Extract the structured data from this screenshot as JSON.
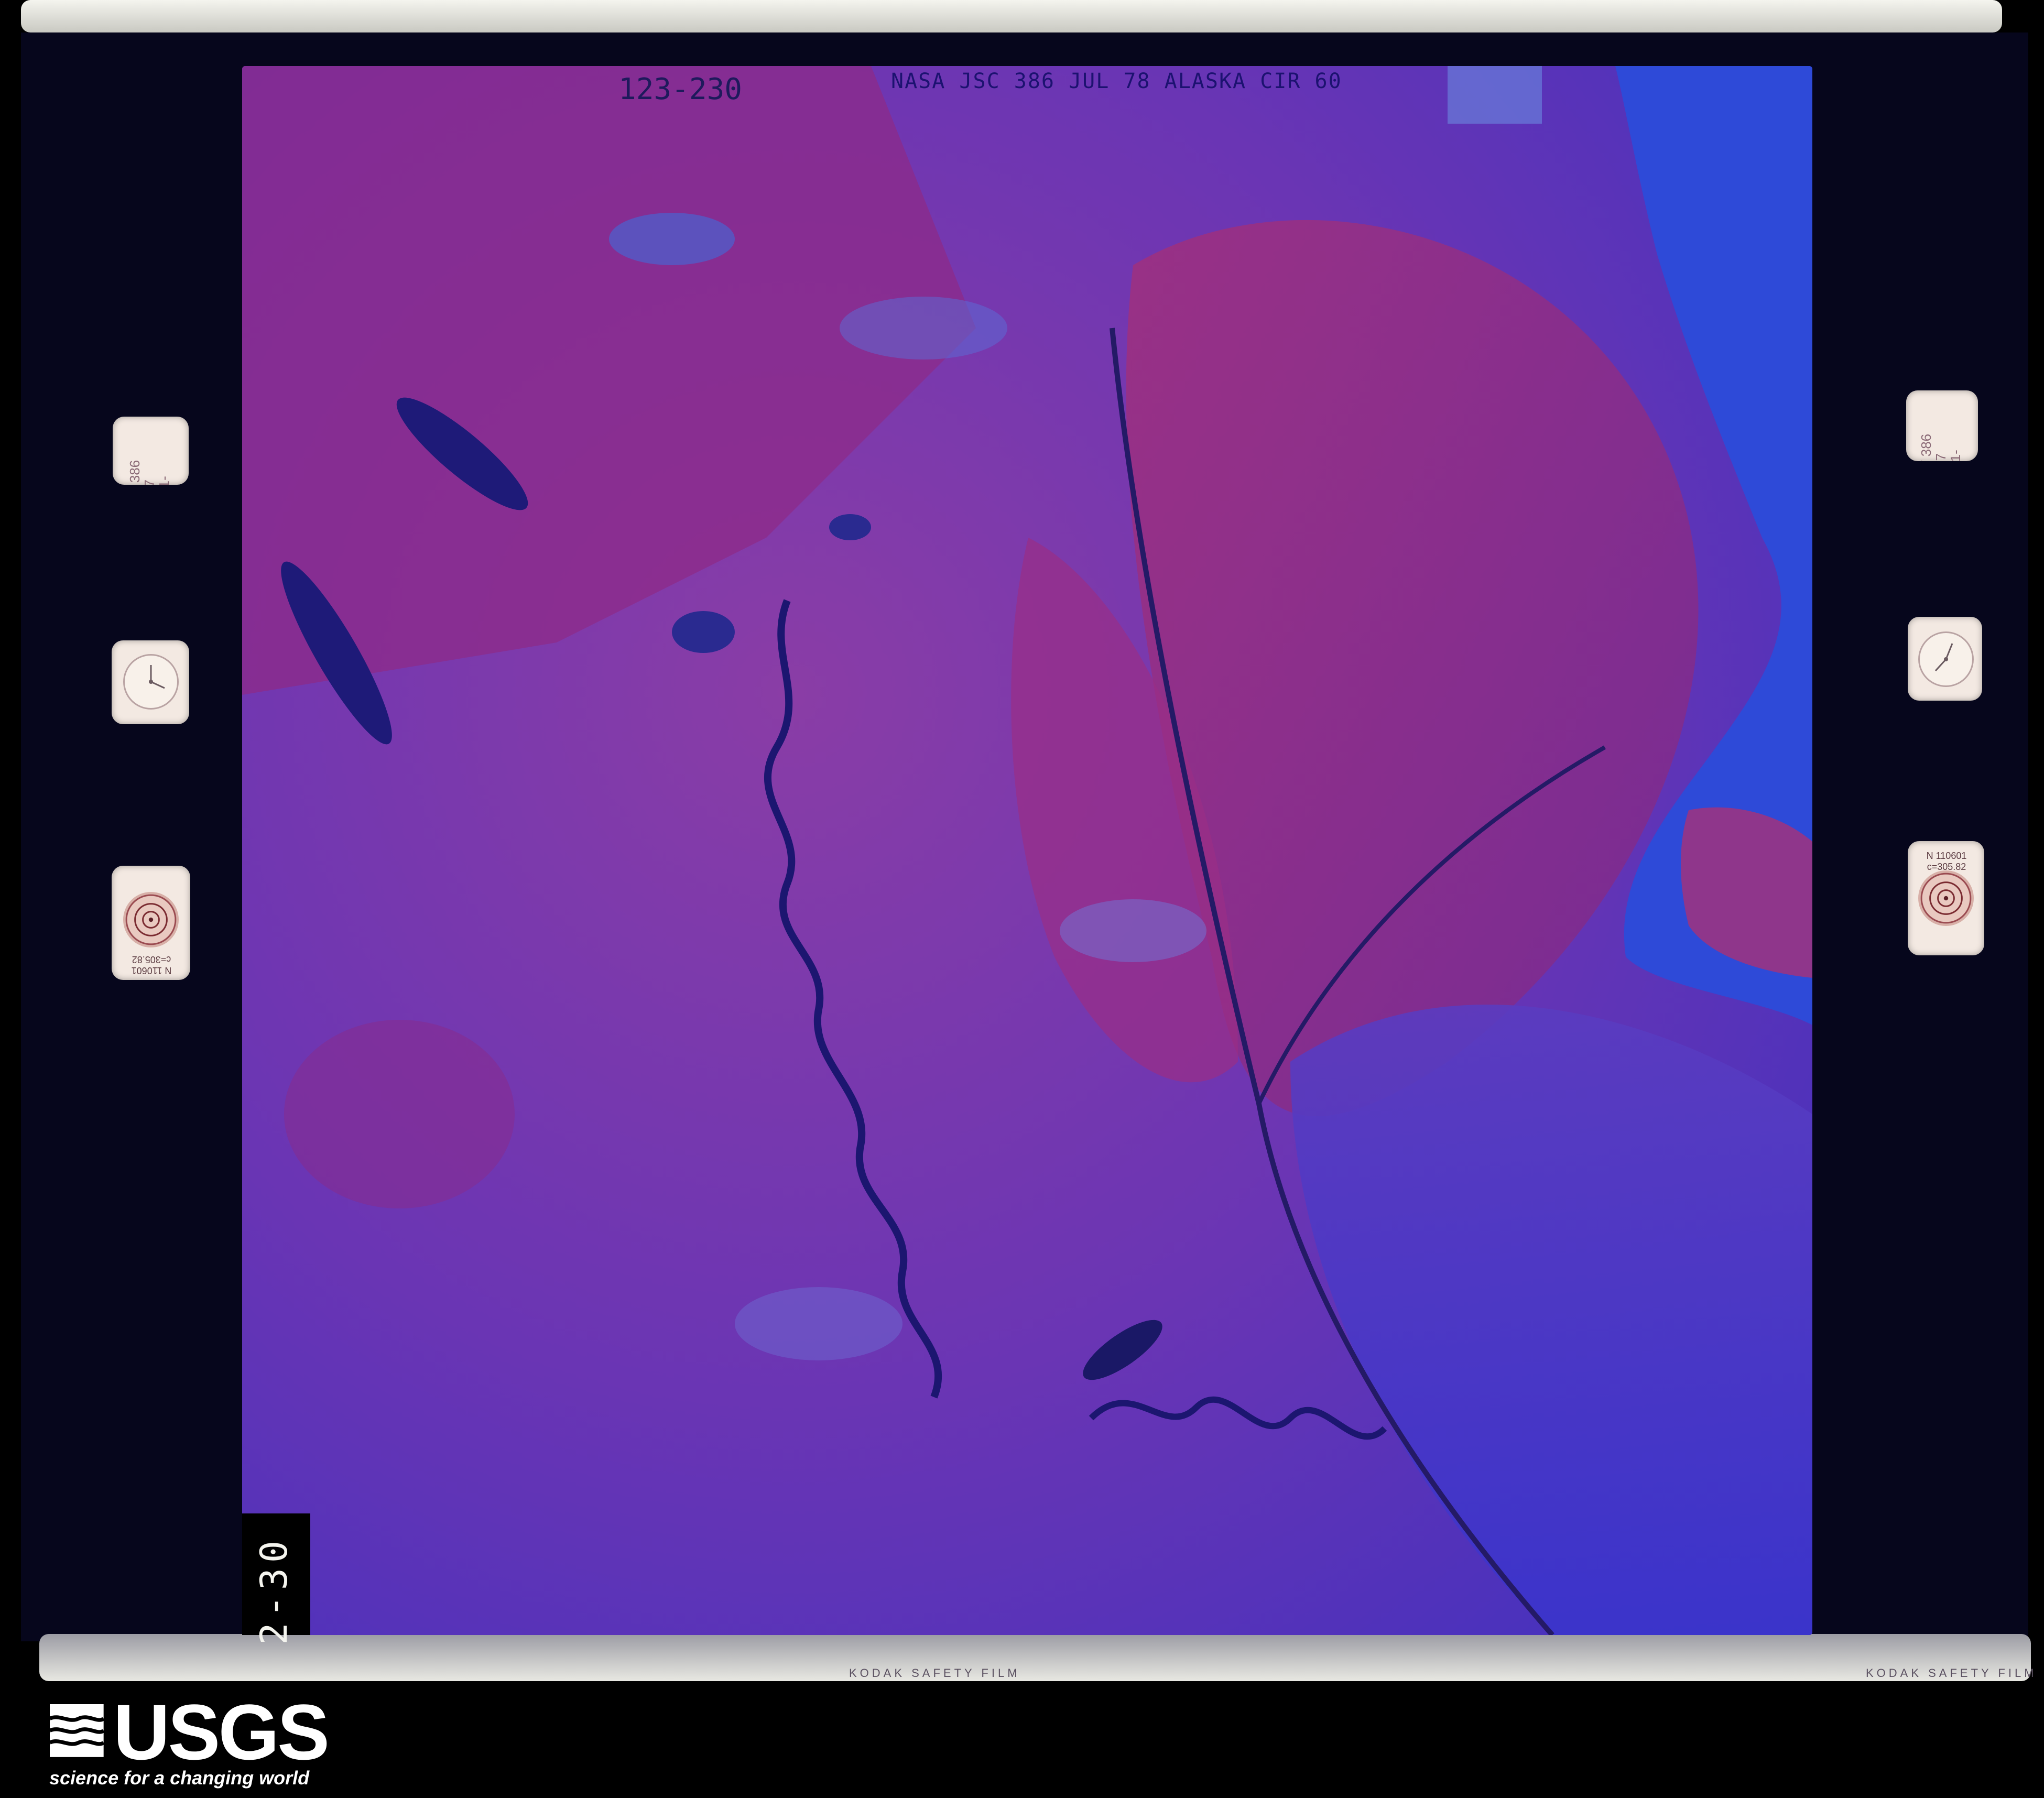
{
  "film": {
    "frame_id": "123-230",
    "header": "NASA JSC 386 JUL 78 ALASKA CIR 60",
    "frame_number": "2-30",
    "edge_print_bottom_left": "KODAK SAFETY FILM",
    "edge_print_bottom_right": "KODAK SAFETY FILM"
  },
  "side_labels": {
    "left_card": "MY 386\nFJ-7\n7-11-",
    "right_card": "MY 386\nFJ-7\n7-11-",
    "lens_left": "N 110601  c=305.82",
    "lens_right": "N 110601  c=305.82"
  },
  "branding": {
    "logo_word": "USGS",
    "tagline": "science for a changing world"
  },
  "colors": {
    "background": "#000000",
    "film_base": "#06061c",
    "land_infrared": "#8a2c8c",
    "water": "#2e48d8",
    "usgs_white": "#ffffff"
  },
  "icons": {
    "left_clock": "clock-icon",
    "right_clock": "clock-icon",
    "left_target": "fiducial-target-icon",
    "right_target": "fiducial-target-icon",
    "usgs_mark": "usgs-wave-icon"
  }
}
